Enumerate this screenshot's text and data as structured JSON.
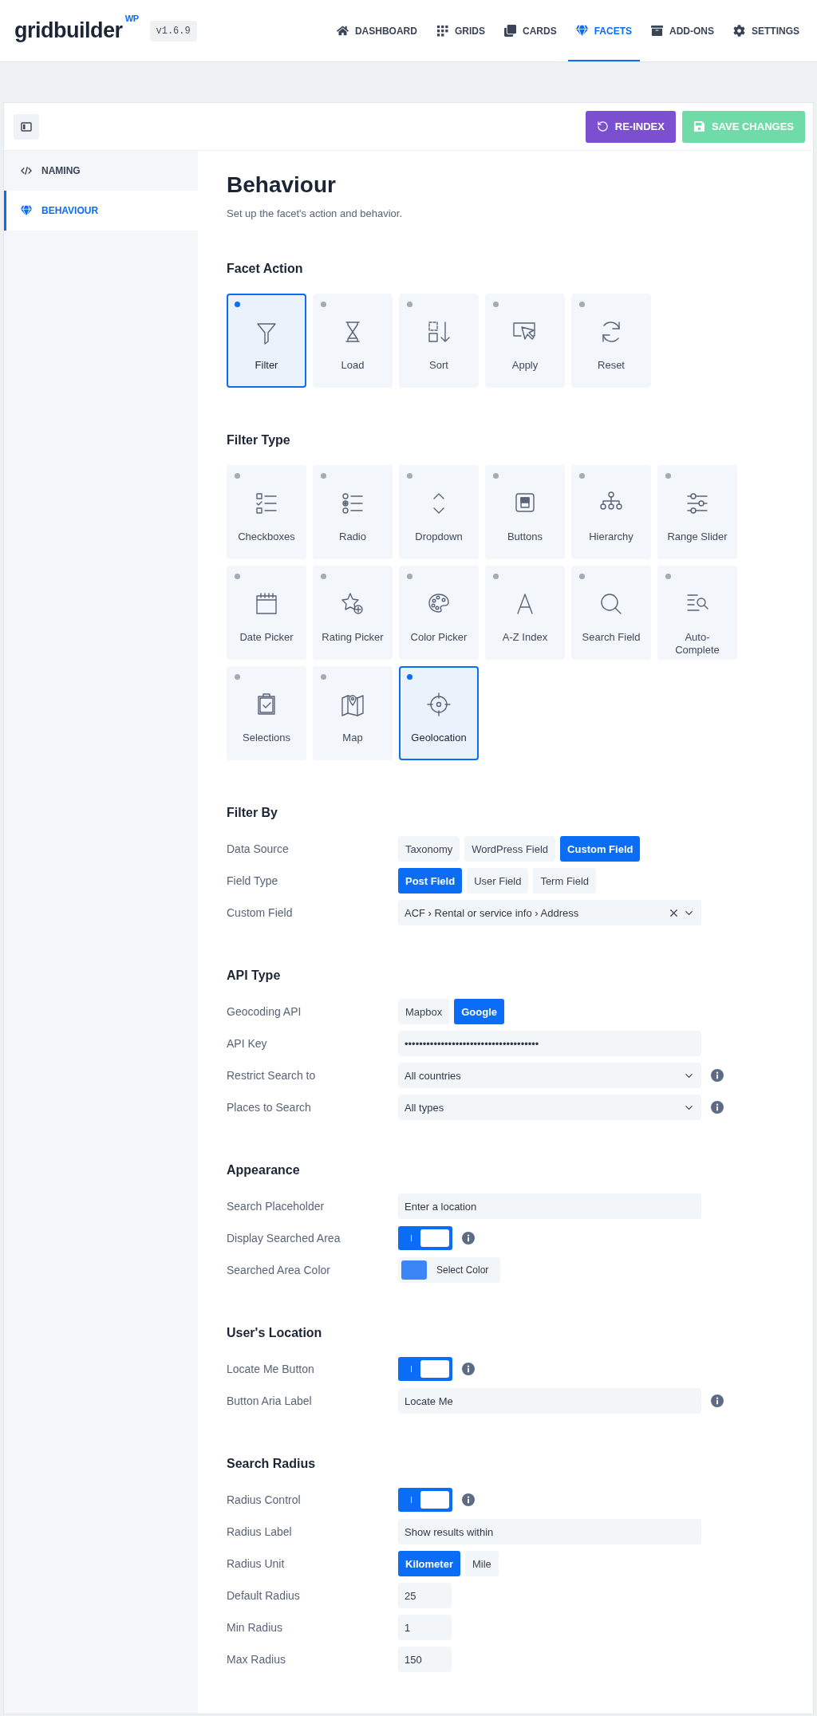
{
  "header": {
    "logo": "gridbuilder",
    "logo_badge": "WP",
    "version": "v1.6.9",
    "nav": [
      {
        "label": "DASHBOARD",
        "selected": false
      },
      {
        "label": "GRIDS",
        "selected": false
      },
      {
        "label": "CARDS",
        "selected": false
      },
      {
        "label": "FACETS",
        "selected": true
      },
      {
        "label": "ADD-ONS",
        "selected": false
      },
      {
        "label": "SETTINGS",
        "selected": false
      }
    ]
  },
  "toolbar": {
    "buttons": [
      {
        "label": "RE-INDEX",
        "kind": "reindex",
        "disabled": false
      },
      {
        "label": "SAVE CHANGES",
        "kind": "save",
        "disabled": true
      }
    ]
  },
  "sidebar": {
    "items": [
      {
        "label": "NAMING",
        "selected": false
      },
      {
        "label": "BEHAVIOUR",
        "selected": true
      }
    ]
  },
  "page": {
    "title": "Behaviour",
    "subtitle": "Set up the facet's action and behavior."
  },
  "facet_action": {
    "title": "Facet Action",
    "options": [
      {
        "label": "Filter",
        "selected": true
      },
      {
        "label": "Load",
        "selected": false
      },
      {
        "label": "Sort",
        "selected": false
      },
      {
        "label": "Apply",
        "selected": false
      },
      {
        "label": "Reset",
        "selected": false
      }
    ]
  },
  "filter_type": {
    "title": "Filter Type",
    "options": [
      {
        "label": "Checkboxes",
        "selected": false
      },
      {
        "label": "Radio",
        "selected": false
      },
      {
        "label": "Dropdown",
        "selected": false
      },
      {
        "label": "Buttons",
        "selected": false
      },
      {
        "label": "Hierarchy",
        "selected": false
      },
      {
        "label": "Range Slider",
        "selected": false
      },
      {
        "label": "Date Picker",
        "selected": false
      },
      {
        "label": "Rating Picker",
        "selected": false
      },
      {
        "label": "Color Picker",
        "selected": false
      },
      {
        "label": "A-Z Index",
        "selected": false
      },
      {
        "label": "Search Field",
        "selected": false
      },
      {
        "label": "Auto-Complete",
        "selected": false
      },
      {
        "label": "Selections",
        "selected": false
      },
      {
        "label": "Map",
        "selected": false
      },
      {
        "label": "Geolocation",
        "selected": true
      }
    ]
  },
  "sections": [
    {
      "title": "Filter By",
      "rows": [
        {
          "label": "Data Source",
          "kind": "choice",
          "options": [
            {
              "label": "Taxonomy",
              "selected": false
            },
            {
              "label": "WordPress Field",
              "selected": false
            },
            {
              "label": "Custom Field",
              "selected": true
            }
          ]
        },
        {
          "label": "Field Type",
          "kind": "choice",
          "options": [
            {
              "label": "Post Field",
              "selected": true
            },
            {
              "label": "User Field",
              "selected": false
            },
            {
              "label": "Term Field",
              "selected": false
            }
          ]
        },
        {
          "label": "Custom Field",
          "kind": "select",
          "value": "ACF › Rental or service info › Address",
          "clearable": true
        }
      ]
    },
    {
      "title": "API Type",
      "rows": [
        {
          "label": "Geocoding API",
          "kind": "choice",
          "options": [
            {
              "label": "Mapbox",
              "selected": false
            },
            {
              "label": "Google",
              "selected": true
            }
          ]
        },
        {
          "label": "API Key",
          "kind": "text",
          "value": "•••••••••••••••••••••••••••••••••••••"
        },
        {
          "label": "Restrict Search to",
          "kind": "select",
          "value": "All countries",
          "info": true
        },
        {
          "label": "Places to Search",
          "kind": "select",
          "value": "All types",
          "info": true
        }
      ]
    },
    {
      "title": "Appearance",
      "rows": [
        {
          "label": "Search Placeholder",
          "kind": "text",
          "value": "Enter a location"
        },
        {
          "label": "Display Searched Area",
          "kind": "toggle",
          "on": true,
          "info": true
        },
        {
          "label": "Searched Area Color",
          "kind": "color",
          "color": "#3b86f7",
          "button": "Select Color"
        }
      ]
    },
    {
      "title": "User's Location",
      "rows": [
        {
          "label": "Locate Me Button",
          "kind": "toggle",
          "on": true,
          "info": true
        },
        {
          "label": "Button Aria Label",
          "kind": "text",
          "value": "Locate Me",
          "info": true
        }
      ]
    },
    {
      "title": "Search Radius",
      "rows": [
        {
          "label": "Radius Control",
          "kind": "toggle",
          "on": true,
          "info": true
        },
        {
          "label": "Radius Label",
          "kind": "text",
          "value": "Show results within"
        },
        {
          "label": "Radius Unit",
          "kind": "choice",
          "options": [
            {
              "label": "Kilometer",
              "selected": true
            },
            {
              "label": "Mile",
              "selected": false
            }
          ]
        },
        {
          "label": "Default Radius",
          "kind": "number",
          "value": "25"
        },
        {
          "label": "Min Radius",
          "kind": "number",
          "value": "1"
        },
        {
          "label": "Max Radius",
          "kind": "number",
          "value": "150"
        }
      ]
    }
  ]
}
